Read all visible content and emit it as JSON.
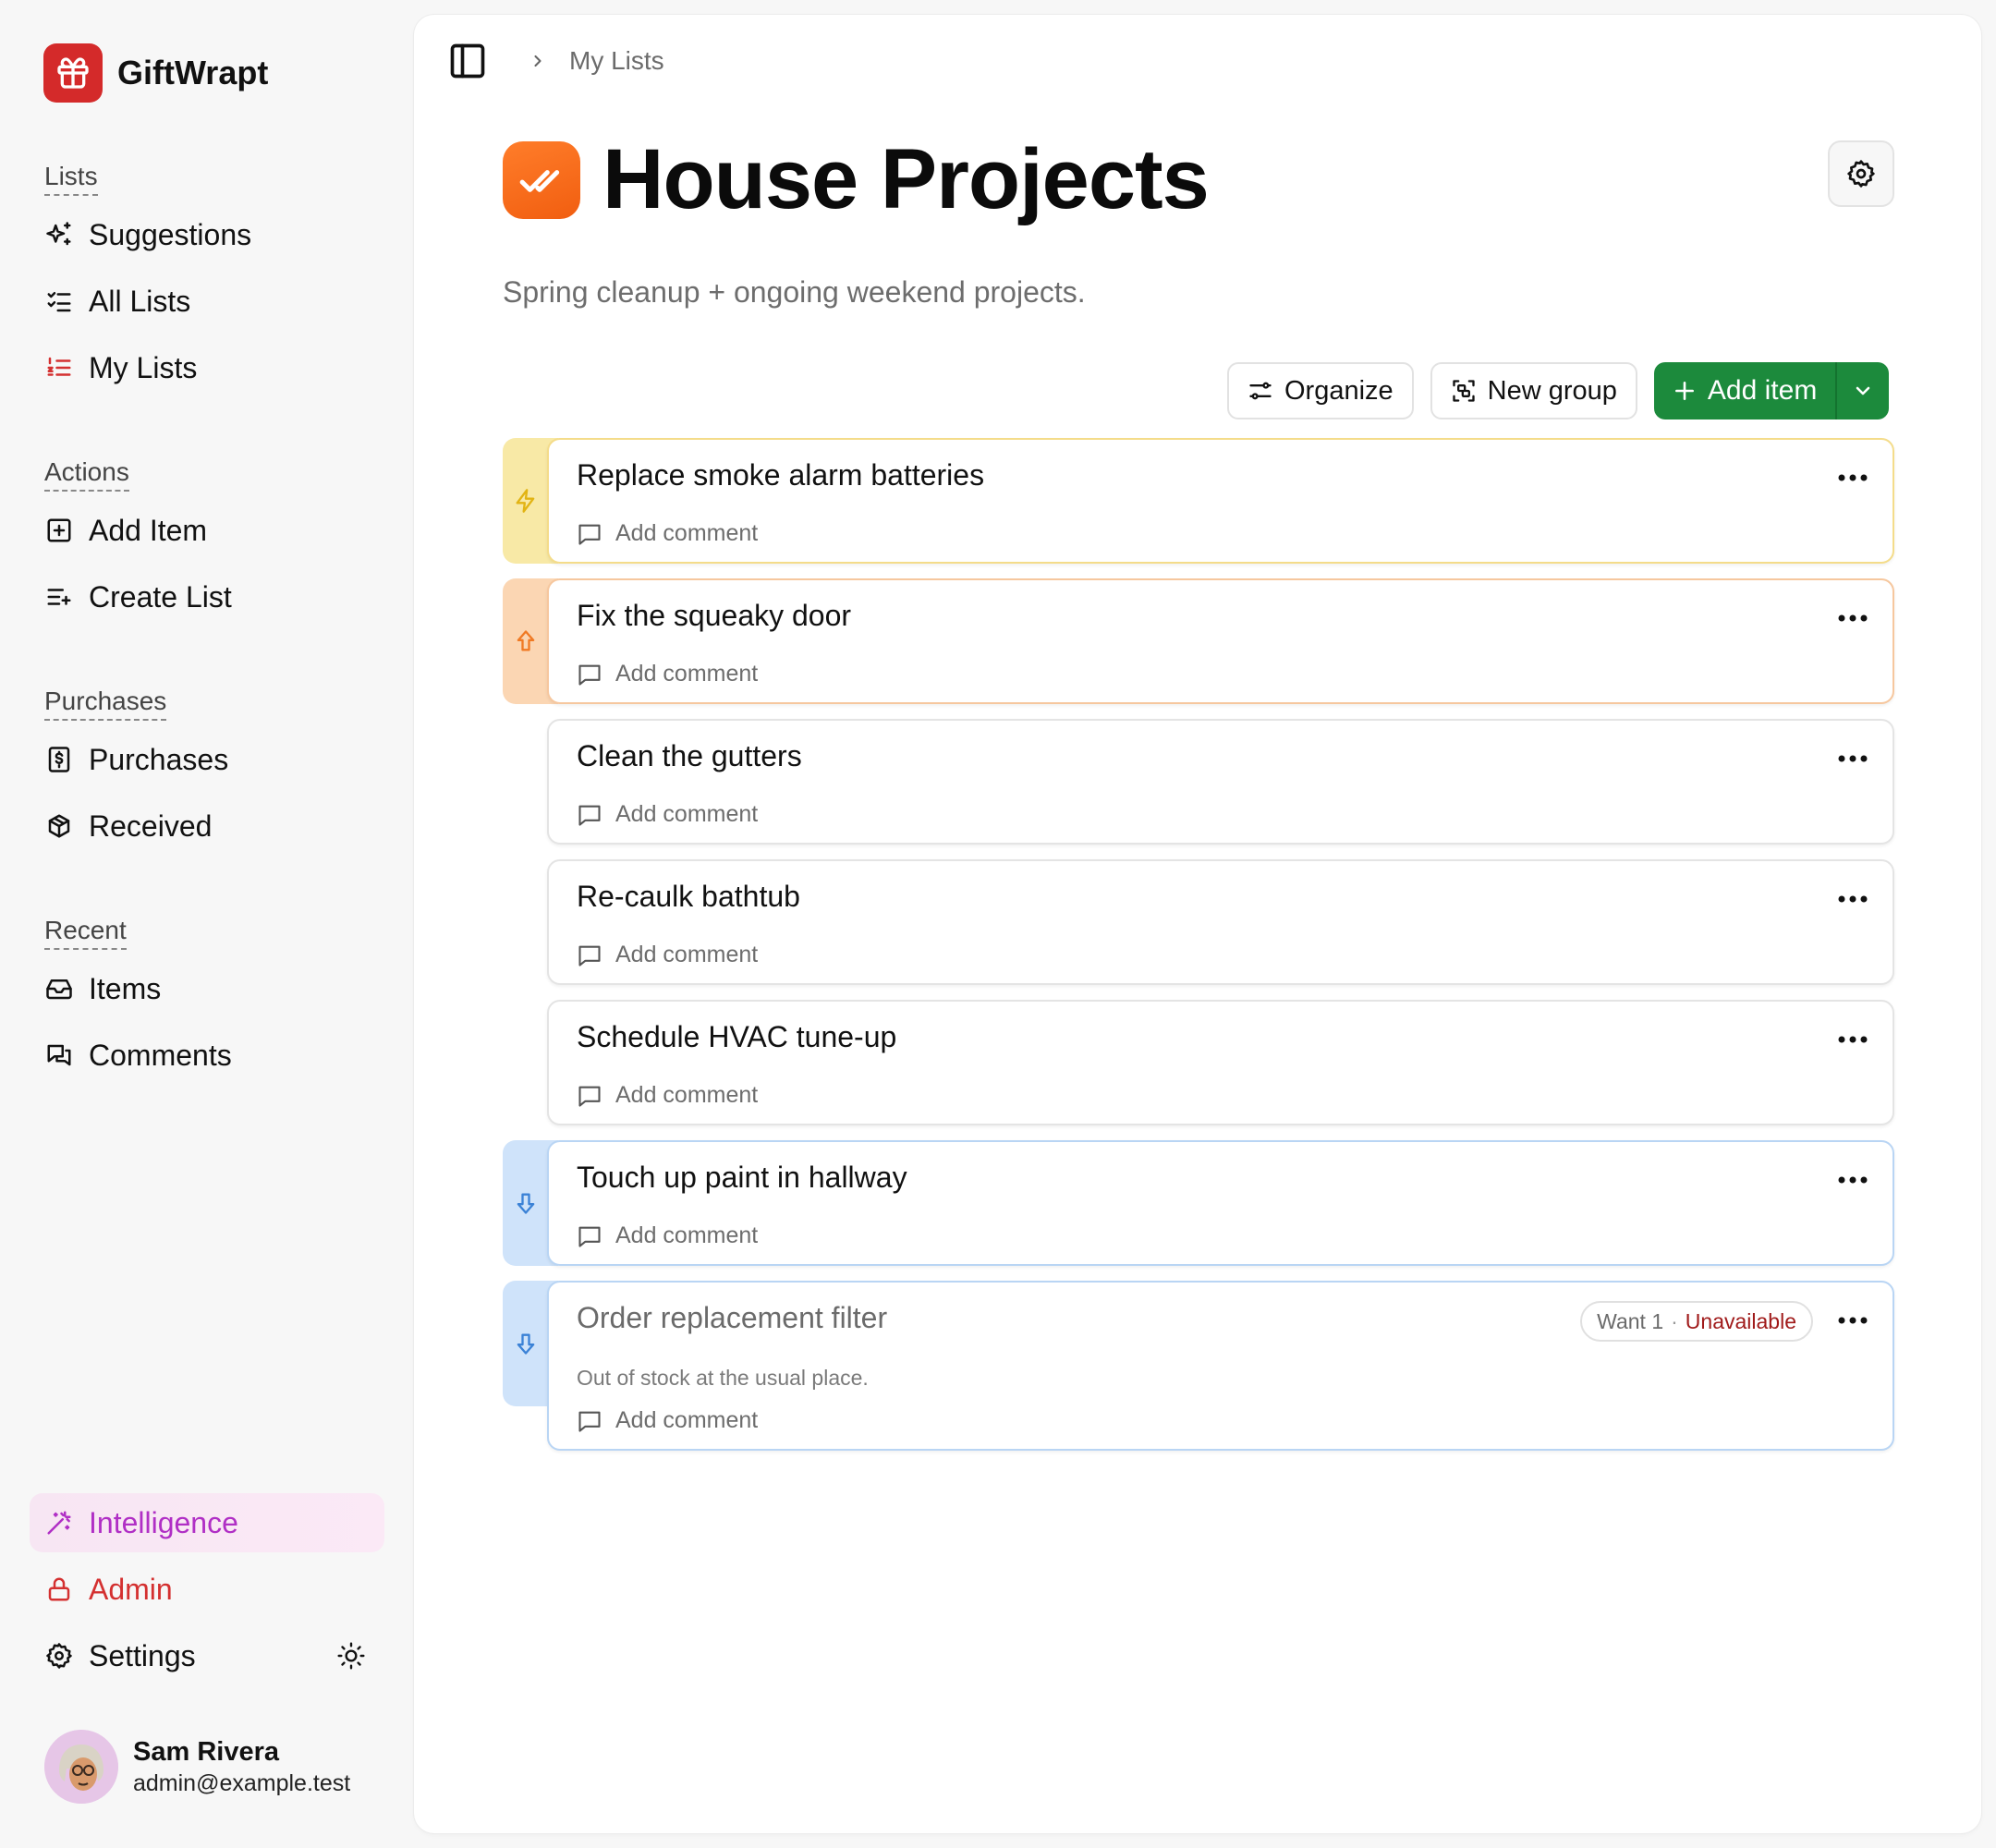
{
  "app": {
    "name": "GiftWrapt"
  },
  "sidebar": {
    "sections": {
      "lists": "Lists",
      "actions": "Actions",
      "purchases": "Purchases",
      "recent": "Recent"
    },
    "lists_items": [
      {
        "label": "Suggestions",
        "icon": "sparkles-icon"
      },
      {
        "label": "All Lists",
        "icon": "list-checks-icon"
      },
      {
        "label": "My Lists",
        "icon": "list-ordered-icon"
      }
    ],
    "actions_items": [
      {
        "label": "Add Item",
        "icon": "plus-square-icon"
      },
      {
        "label": "Create List",
        "icon": "list-plus-icon"
      }
    ],
    "purchases_items": [
      {
        "label": "Purchases",
        "icon": "receipt-dollar-icon"
      },
      {
        "label": "Received",
        "icon": "package-icon"
      }
    ],
    "recent_items": [
      {
        "label": "Items",
        "icon": "inbox-icon"
      },
      {
        "label": "Comments",
        "icon": "messages-icon"
      }
    ],
    "bottom_items": [
      {
        "label": "Intelligence",
        "icon": "magic-wand-icon",
        "color": "#b02fc5"
      },
      {
        "label": "Admin",
        "icon": "lock-icon",
        "color": "#d43030"
      },
      {
        "label": "Settings",
        "icon": "gear-icon"
      }
    ],
    "user": {
      "name": "Sam Rivera",
      "email": "admin@example.test"
    }
  },
  "header": {
    "breadcrumb": "My Lists",
    "title": "House Projects",
    "description": "Spring cleanup + ongoing weekend projects."
  },
  "toolbar": {
    "organize": "Organize",
    "new_group": "New group",
    "add_item": "Add item"
  },
  "items": [
    {
      "name": "Replace smoke alarm batteries",
      "priority": "highest",
      "priority_icon": "lightning-icon",
      "comment": "Add comment"
    },
    {
      "name": "Fix the squeaky door",
      "priority": "high",
      "priority_icon": "arrow-up-icon",
      "comment": "Add comment"
    },
    {
      "name": "Clean the gutters",
      "priority": "normal",
      "comment": "Add comment"
    },
    {
      "name": "Re-caulk bathtub",
      "priority": "normal",
      "comment": "Add comment"
    },
    {
      "name": "Schedule HVAC tune-up",
      "priority": "normal",
      "comment": "Add comment"
    },
    {
      "name": "Touch up paint in hallway",
      "priority": "low",
      "priority_icon": "arrow-down-icon",
      "comment": "Add comment"
    },
    {
      "name": "Order replacement filter",
      "priority": "low",
      "priority_icon": "arrow-down-icon",
      "comment": "Add comment",
      "note": "Out of stock at the usual place.",
      "want": "Want 1",
      "separator": "·",
      "status": "Unavailable"
    }
  ],
  "colors": {
    "brand": "#d42a2a",
    "list_icon": "#f26a18",
    "add_button": "#1c8a3c",
    "priority_highest": "#f8e9a6",
    "priority_high": "#fbd6b3",
    "priority_low": "#cfe3fa",
    "unavailable": "#a01a1a"
  }
}
